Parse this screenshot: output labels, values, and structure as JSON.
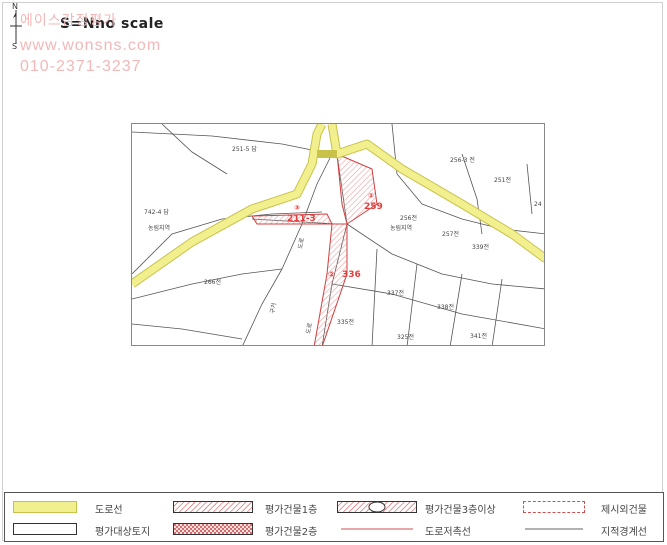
{
  "header": {
    "north_label": "N",
    "south_label": "S",
    "scale_title": "S=Nno scale"
  },
  "watermark": {
    "line1": "에이스감정평가",
    "line2": "www.wonsns.com",
    "line3": "010-2371-3237"
  },
  "map": {
    "parcels": {
      "p251_5": "251-5 답",
      "p256_3": "256-3 전",
      "p251": "251전",
      "p24": "24",
      "p242_4": "742-4 답",
      "nongrim": "농림지역",
      "p256": "256전",
      "nongrim2": "농림지역",
      "p257": "257전",
      "p339": "339전",
      "p266": "266전",
      "p337": "337전",
      "p338": "338전",
      "p335": "335전",
      "p325": "325전",
      "p341": "341전",
      "road_a": "도로",
      "road_b": "구거",
      "road_c": "도로"
    },
    "subjects": {
      "s1_num": "①",
      "s1_lot": "259",
      "s2_num": "②",
      "s2_lot": "336",
      "s3_num": "③",
      "s3_lot": "211-3"
    },
    "colors": {
      "road": "#f2ef8f",
      "road_edge": "#c8c24a",
      "subject": "#e53b3b",
      "hatch": "#f3b8b8",
      "line": "#555555"
    }
  },
  "legend": {
    "items": [
      {
        "label": "도로선"
      },
      {
        "label": "평가건물1층"
      },
      {
        "label": "평가건물3층이상"
      },
      {
        "label": "제시외건물"
      },
      {
        "label": "평가대상토지"
      },
      {
        "label": "평가건물2층"
      },
      {
        "label": "도로저촉선"
      },
      {
        "label": "지적경계선"
      }
    ]
  }
}
